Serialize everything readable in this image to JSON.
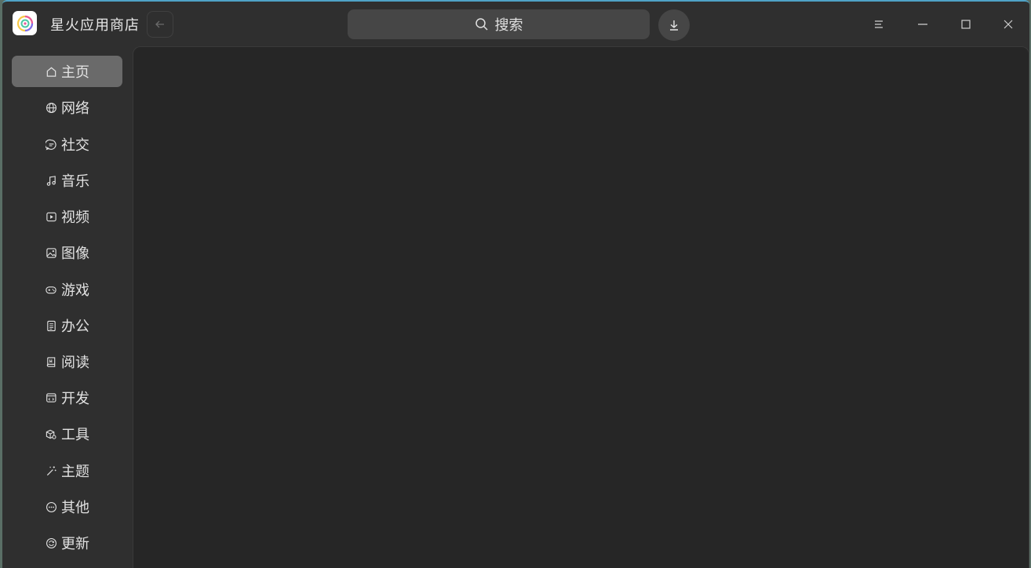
{
  "app": {
    "title": "星火应用商店",
    "accent_color": "#4fa3c7"
  },
  "search": {
    "label": "搜索"
  },
  "sidebar": {
    "items": [
      {
        "label": "主页",
        "icon": "home-icon",
        "active": true
      },
      {
        "label": "网络",
        "icon": "globe-icon"
      },
      {
        "label": "社交",
        "icon": "chat-icon"
      },
      {
        "label": "音乐",
        "icon": "music-icon"
      },
      {
        "label": "视频",
        "icon": "video-icon"
      },
      {
        "label": "图像",
        "icon": "image-icon"
      },
      {
        "label": "游戏",
        "icon": "gamepad-icon"
      },
      {
        "label": "办公",
        "icon": "document-icon"
      },
      {
        "label": "阅读",
        "icon": "book-icon"
      },
      {
        "label": "开发",
        "icon": "code-icon"
      },
      {
        "label": "工具",
        "icon": "toolbox-icon"
      },
      {
        "label": "主题",
        "icon": "magic-wand-icon"
      },
      {
        "label": "其他",
        "icon": "more-icon"
      },
      {
        "label": "更新",
        "icon": "update-icon"
      }
    ]
  }
}
